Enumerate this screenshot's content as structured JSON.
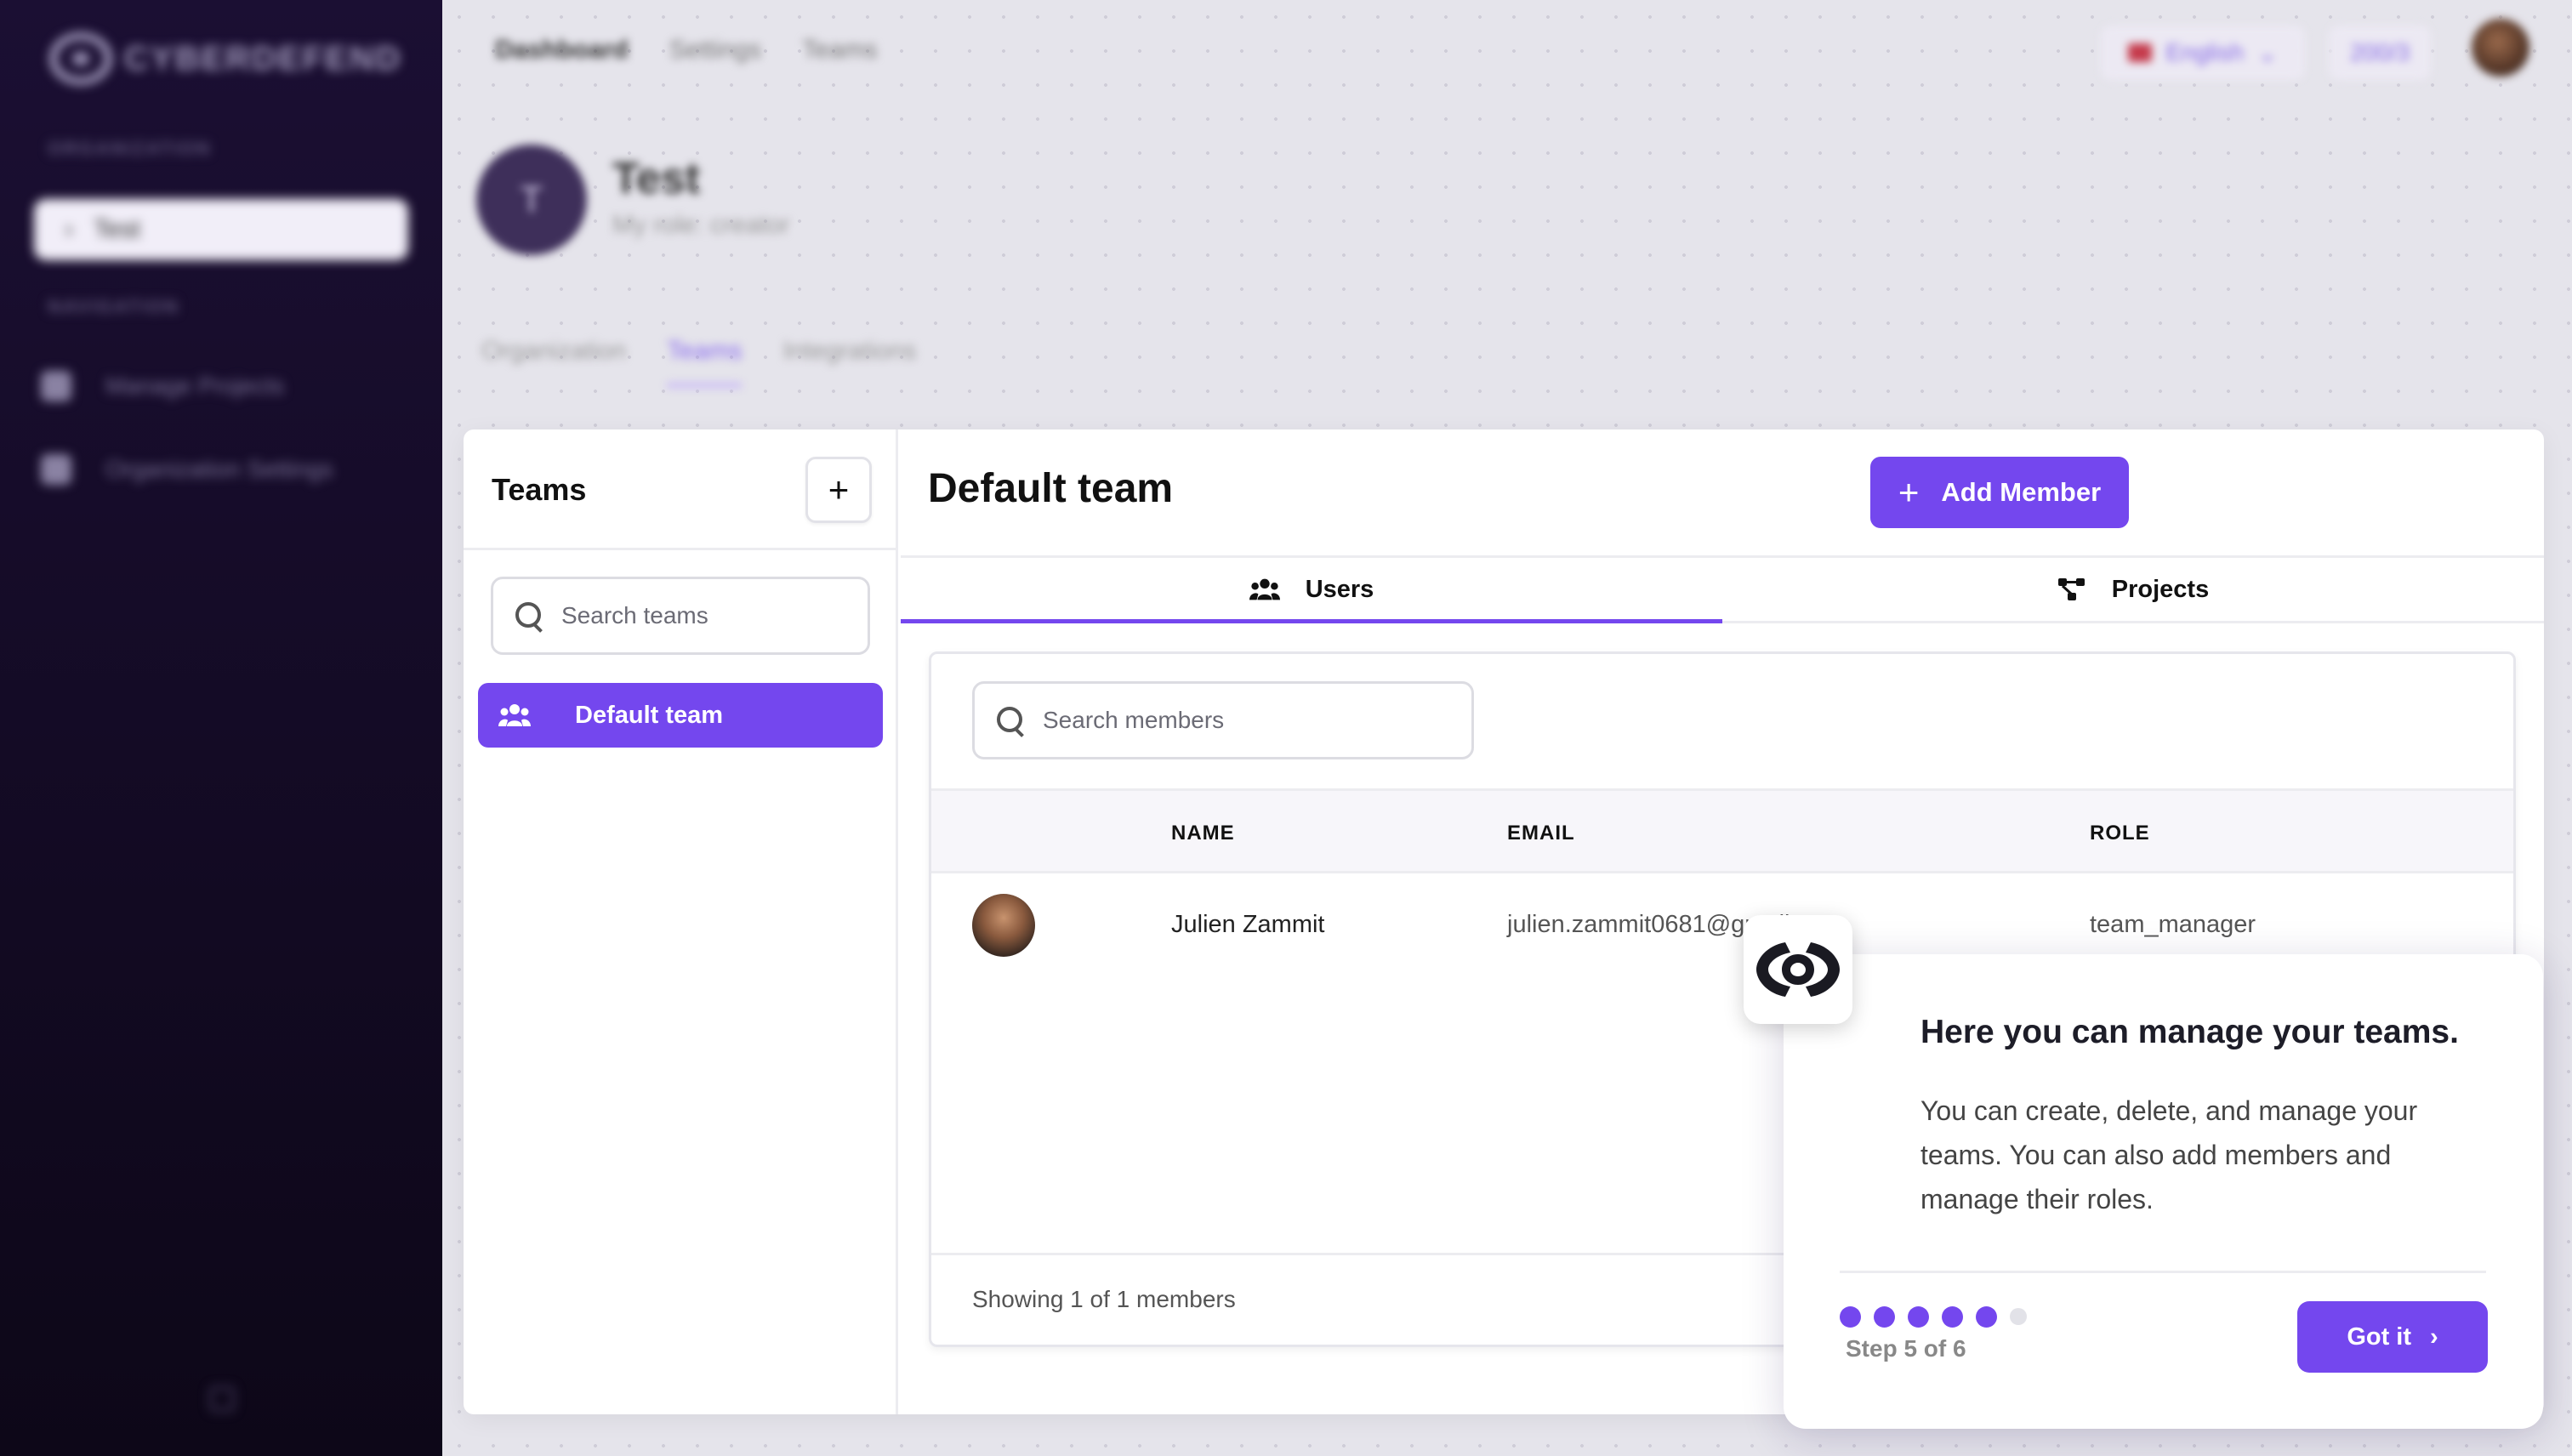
{
  "sidebar": {
    "brand": "CYBERDEFEND",
    "section_org": "ORGANIZATION",
    "org_item": "Test",
    "section_nav": "NAVIGATION",
    "nav_items": [
      {
        "label": "Manage Projects"
      },
      {
        "label": "Organization Settings"
      }
    ]
  },
  "header": {
    "breadcrumbs": [
      "Dashboard",
      "Settings",
      "Teams"
    ],
    "language": "English",
    "credits": "200/3"
  },
  "org": {
    "initial": "T",
    "name": "Test",
    "role": "My role: creator"
  },
  "page_tabs": [
    "Organization",
    "Teams",
    "Integrations"
  ],
  "teams_panel": {
    "title": "Teams",
    "add_label": "+",
    "search_placeholder": "Search teams",
    "teams": [
      {
        "name": "Default team"
      }
    ]
  },
  "team_detail": {
    "title": "Default team",
    "add_member_label": "Add Member",
    "tabs": [
      {
        "label": "Users",
        "active": true
      },
      {
        "label": "Projects",
        "active": false
      }
    ],
    "search_placeholder": "Search members",
    "columns": [
      "NAME",
      "EMAIL",
      "ROLE"
    ],
    "members": [
      {
        "name": "Julien Zammit",
        "email": "julien.zammit0681@gmail.com",
        "role": "team_manager"
      }
    ],
    "footer": "Showing 1 of 1 members"
  },
  "tour": {
    "title": "Here you can manage your teams.",
    "body": "You can create, delete, and manage your teams. You can also add members and manage their roles.",
    "step_text": "Step 5 of 6",
    "current_step": 5,
    "total_steps": 6,
    "button_label": "Got it"
  },
  "colors": {
    "accent": "#7447ee",
    "sidebar_bg": "#1b0f33"
  }
}
